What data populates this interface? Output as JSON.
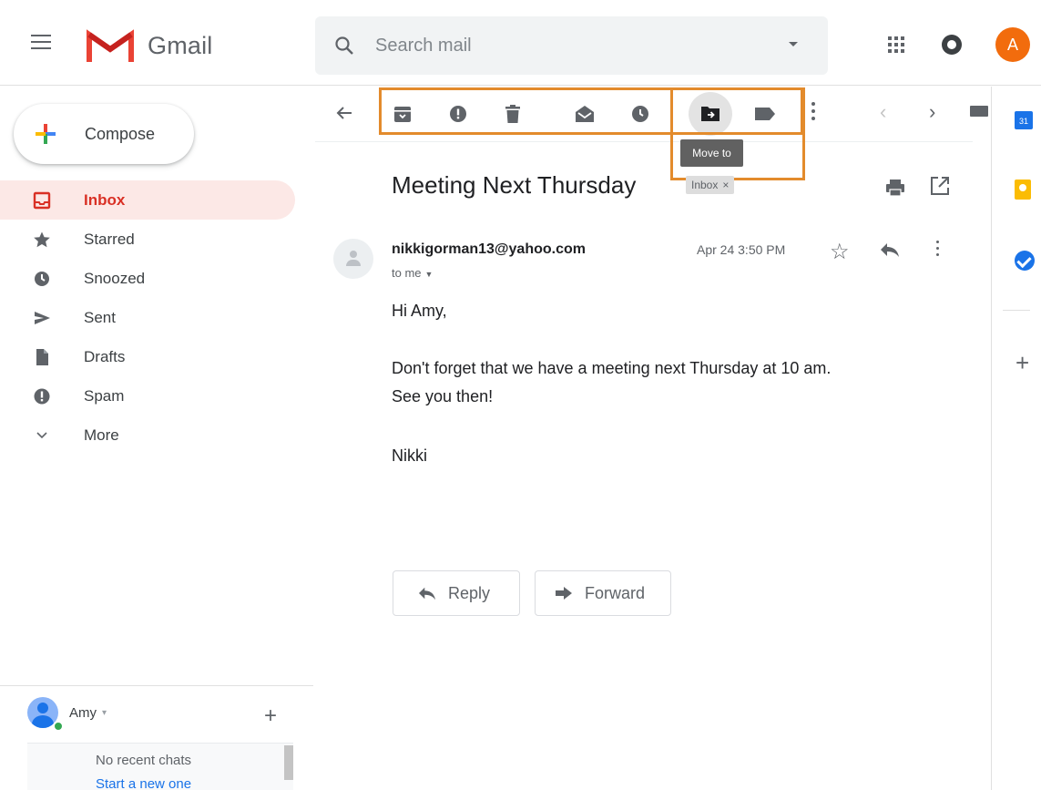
{
  "header": {
    "app_name": "Gmail",
    "search_placeholder": "Search mail",
    "avatar_initial": "A"
  },
  "sidebar": {
    "compose_label": "Compose",
    "items": [
      {
        "label": "Inbox",
        "icon": "inbox-icon",
        "active": true
      },
      {
        "label": "Starred",
        "icon": "star-icon"
      },
      {
        "label": "Snoozed",
        "icon": "clock-icon"
      },
      {
        "label": "Sent",
        "icon": "send-icon"
      },
      {
        "label": "Drafts",
        "icon": "draft-icon"
      },
      {
        "label": "Spam",
        "icon": "spam-icon"
      },
      {
        "label": "More",
        "icon": "chevron-down-icon"
      }
    ]
  },
  "chat": {
    "user_name": "Amy",
    "empty_text": "No recent chats",
    "start_link": "Start a new one"
  },
  "toolbar": {
    "tooltip": "Move to",
    "actions": [
      "archive-icon",
      "report-spam-icon",
      "delete-icon",
      "mark-unread-icon",
      "snooze-icon",
      "move-to-icon",
      "label-icon"
    ]
  },
  "side_panel": {
    "calendar_day": "31"
  },
  "message": {
    "subject": "Meeting Next Thursday",
    "label_chip": "Inbox",
    "label_remove": "×",
    "sender": "nikkigorman13@yahoo.com",
    "recipient": "to me",
    "date": "Apr 24 3:50 PM",
    "body": {
      "greeting": "Hi Amy,",
      "line1": "Don't forget that we have a meeting next Thursday at 10 am.",
      "line2": "See you then!",
      "signature": "Nikki"
    }
  },
  "actions": {
    "reply_label": "Reply",
    "forward_label": "Forward"
  },
  "colors": {
    "accent_red": "#d93025",
    "highlight_orange": "#e38b2c",
    "avatar_orange": "#f26c0d"
  }
}
